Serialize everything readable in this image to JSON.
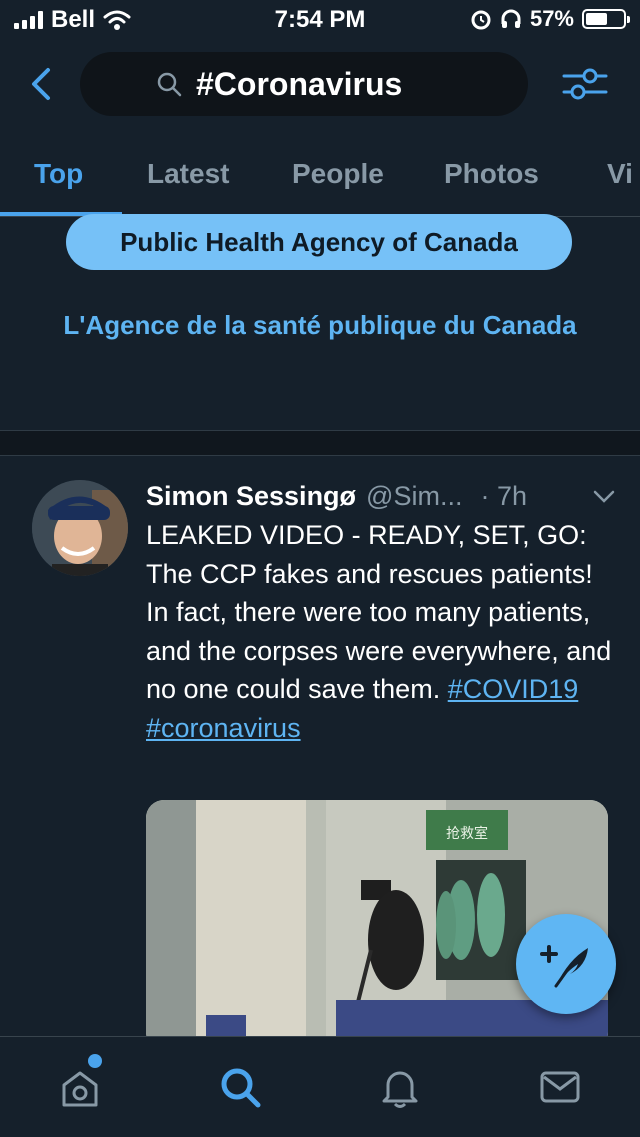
{
  "status_bar": {
    "carrier": "Bell",
    "time": "7:54 PM",
    "battery": "57%",
    "battery_level": 0.57
  },
  "search": {
    "query": "#Coronavirus"
  },
  "tabs": [
    {
      "label": "Top",
      "active": true
    },
    {
      "label": "Latest",
      "active": false
    },
    {
      "label": "People",
      "active": false
    },
    {
      "label": "Photos",
      "active": false
    },
    {
      "label": "Vi",
      "active": false
    }
  ],
  "promo": {
    "button_label": "Public Health Agency of Canada",
    "link_text": "L'Agence de la santé publique du Canada"
  },
  "tweet": {
    "name": "Simon Sessingø",
    "handle": "@Sim...",
    "time": "· 7h",
    "text": "LEAKED VIDEO - READY, SET, GO: The CCP fakes and rescues patients! In fact, there were too many patients, and the corpses were everywhere, and no one could save them.",
    "hashtags": [
      "#COVID19",
      "#coronavirus"
    ],
    "media_sign": "抢救室"
  },
  "colors": {
    "background": "#15202b",
    "accent": "#4aa3ec",
    "muted": "#8899a6"
  },
  "icons": {
    "back": "chevron-left-icon",
    "search": "search-icon",
    "filter": "sliders-icon",
    "compose": "compose-tweet-icon",
    "home": "home-icon",
    "explore": "search-icon",
    "notifications": "bell-icon",
    "messages": "mail-icon"
  }
}
